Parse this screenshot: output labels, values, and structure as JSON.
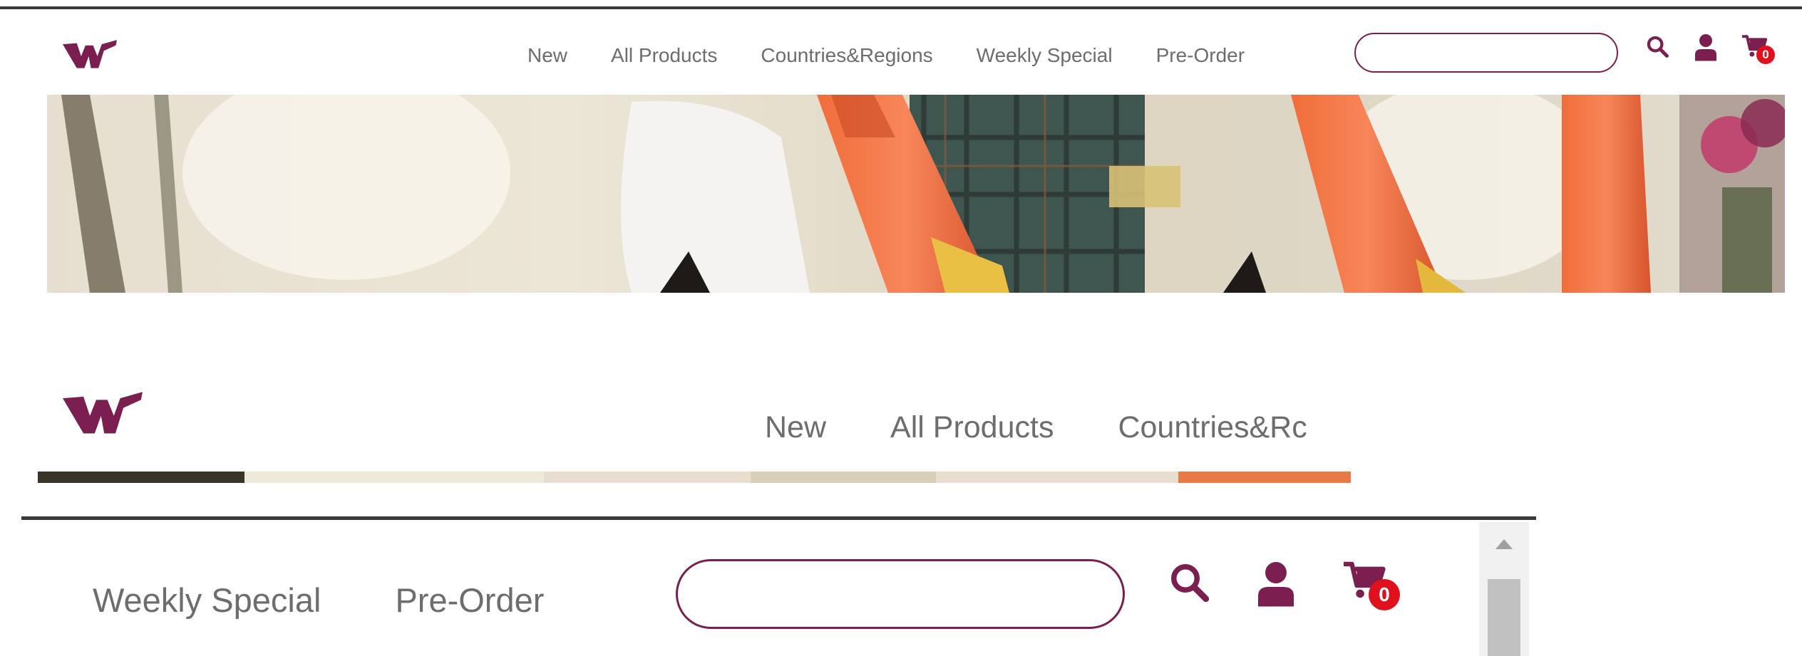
{
  "brand": {
    "color": "#7a1f4f",
    "logo_icon": "w-logo-icon"
  },
  "nav": {
    "items": [
      {
        "label": "New"
      },
      {
        "label": "All Products"
      },
      {
        "label": "Countries&Regions"
      },
      {
        "label": "Weekly Special"
      },
      {
        "label": "Pre-Order"
      }
    ],
    "truncated_item": "Countries&Rc"
  },
  "search": {
    "value": "",
    "placeholder": ""
  },
  "icons": {
    "search": "search-icon",
    "account": "user-icon",
    "cart": "cart-icon"
  },
  "cart": {
    "count": "0",
    "badge_color": "#e0101c"
  },
  "banner": {
    "subject": "champagne-bottles-photo"
  }
}
